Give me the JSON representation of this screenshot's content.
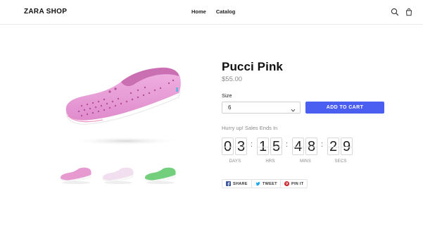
{
  "header": {
    "logo": "ZARA SHOP",
    "nav": [
      {
        "label": "Home"
      },
      {
        "label": "Catalog"
      }
    ],
    "icons": [
      "search-icon",
      "cart-icon"
    ]
  },
  "product": {
    "title": "Pucci Pink",
    "price": "$55.00",
    "size_label": "Size",
    "size_value": "6",
    "add_to_cart": "ADD TO CART",
    "hurry_text": "Hurry up! Sales Ends In",
    "thumbnail_colors": [
      "#e79ad0",
      "#f1dff0",
      "#74cf7c"
    ]
  },
  "countdown": {
    "days": [
      "0",
      "3"
    ],
    "hours": [
      "1",
      "5"
    ],
    "mins": [
      "4",
      "8"
    ],
    "secs": [
      "2",
      "9"
    ],
    "labels": {
      "days": "DAYS",
      "hours": "HRS",
      "mins": "MINS",
      "secs": "SECS"
    },
    "separator": ":"
  },
  "share": {
    "facebook": "SHARE",
    "twitter": "TWEET",
    "pinterest": "PIN IT"
  },
  "colors": {
    "accent": "#4a5ef2",
    "shoe_pink": "#e79ad0",
    "facebook": "#3b5998",
    "twitter": "#1da1f2",
    "pinterest": "#cb2027"
  }
}
